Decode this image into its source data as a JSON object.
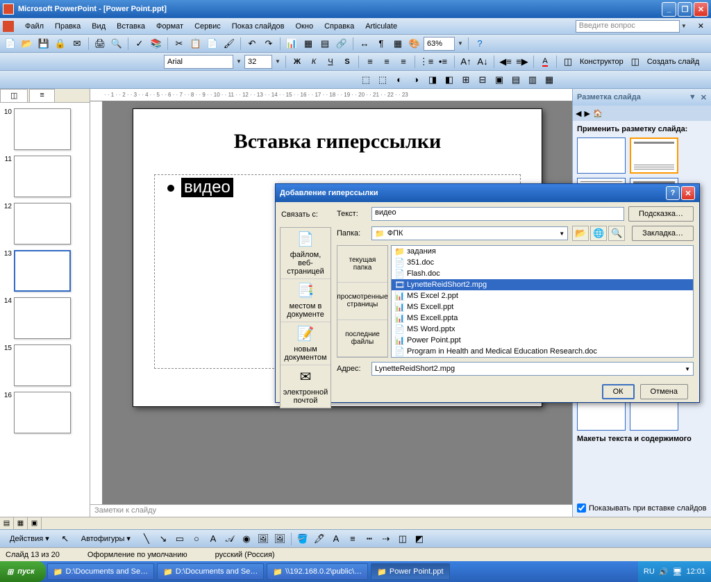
{
  "app": {
    "title": "Microsoft PowerPoint - [Power Point.ppt]"
  },
  "menu": {
    "items": [
      "Файл",
      "Правка",
      "Вид",
      "Вставка",
      "Формат",
      "Сервис",
      "Показ слайдов",
      "Окно",
      "Справка",
      "Articulate"
    ],
    "help_placeholder": "Введите вопрос"
  },
  "format_toolbar": {
    "font": "Arial",
    "size": "32",
    "zoom": "63%",
    "designer_label": "Конструктор",
    "new_slide_label": "Создать слайд"
  },
  "slide_content": {
    "title": "Вставка гиперссылки",
    "bullet": "видео"
  },
  "taskpane": {
    "title": "Разметка слайда",
    "apply_label": "Применить разметку слайда:",
    "section_label": "Макеты текста и содержимого",
    "show_on_insert": "Показывать при вставке слайдов"
  },
  "notes_placeholder": "Заметки к слайду",
  "draw_toolbar": {
    "actions": "Действия",
    "autoshapes": "Автофигуры"
  },
  "status": {
    "slide_num": "Слайд 13 из 20",
    "template": "Оформление по умолчанию",
    "lang": "русский (Россия)"
  },
  "taskbar": {
    "start": "пуск",
    "tasks": [
      "D:\\Documents and Se…",
      "D:\\Documents and Se…",
      "\\\\192.168.0.2\\public\\…",
      "Power Point.ppt"
    ],
    "lang": "RU",
    "time": "12:01"
  },
  "dialog": {
    "title": "Добавление гиперссылки",
    "link_with": "Связать с:",
    "text_label": "Текст:",
    "text_value": "видео",
    "hint_button": "Подсказка…",
    "bookmark_button": "Закладка…",
    "folder_label": "Папка:",
    "folder_value": "ФПК",
    "address_label": "Адрес:",
    "address_value": "LynetteReidShort2.mpg",
    "ok": "ОК",
    "cancel": "Отмена",
    "places": [
      "файлом, веб-страницей",
      "местом в документе",
      "новым документом",
      "электронной почтой"
    ],
    "browse_cats": [
      "текущая папка",
      "просмотренные страницы",
      "последние файлы"
    ],
    "files": [
      {
        "name": "задания",
        "icon": "📁",
        "sel": false
      },
      {
        "name": "351.doc",
        "icon": "📄",
        "sel": false
      },
      {
        "name": "Flash.doc",
        "icon": "📄",
        "sel": false
      },
      {
        "name": "LynetteReidShort2.mpg",
        "icon": "🎞",
        "sel": true
      },
      {
        "name": "MS Excel 2.ppt",
        "icon": "📊",
        "sel": false
      },
      {
        "name": "MS Excell.ppt",
        "icon": "📊",
        "sel": false
      },
      {
        "name": "MS Excell.ppta",
        "icon": "📊",
        "sel": false
      },
      {
        "name": "MS Word.pptx",
        "icon": "📄",
        "sel": false
      },
      {
        "name": "Power Point.ppt",
        "icon": "📊",
        "sel": false
      },
      {
        "name": "Program in Health and Medical Education Research.doc",
        "icon": "📄",
        "sel": false
      }
    ]
  },
  "thumbnails": [
    10,
    11,
    12,
    13,
    14,
    15,
    16
  ]
}
